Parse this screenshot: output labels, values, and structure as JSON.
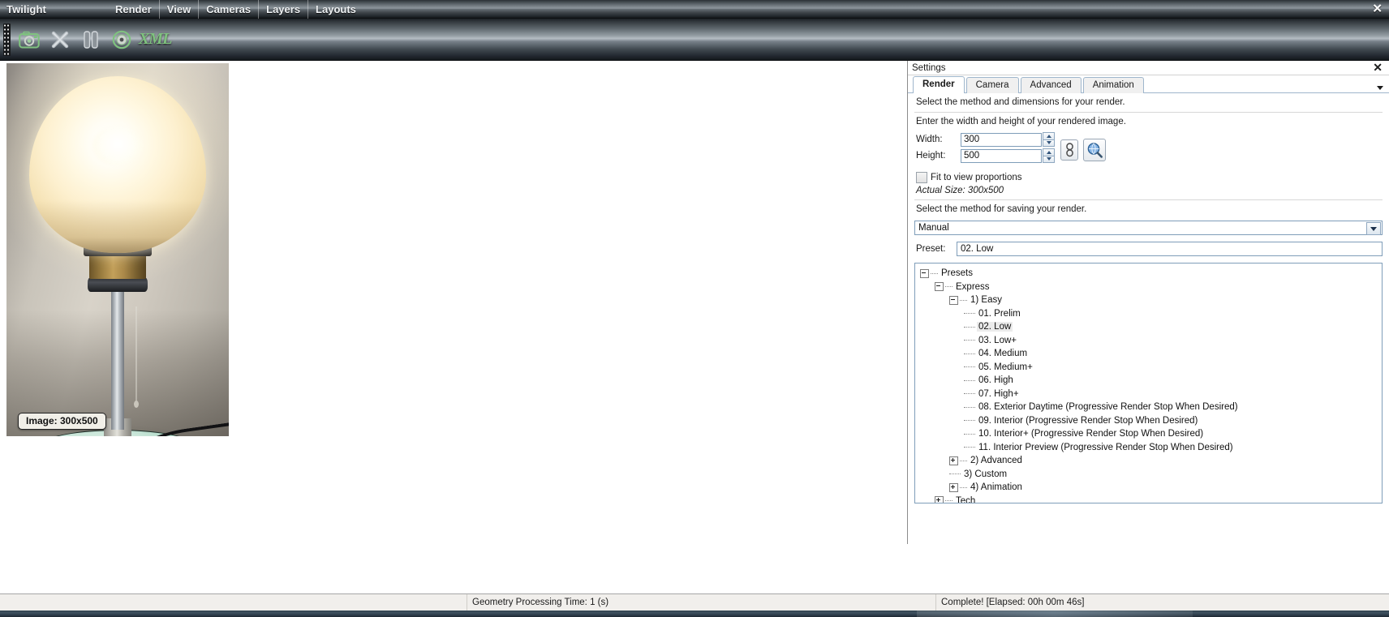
{
  "titlebar": {
    "app_name": "Twilight",
    "menu": [
      "Render",
      "View",
      "Cameras",
      "Layers",
      "Layouts"
    ],
    "close_label": "✕"
  },
  "toolbar": {
    "buttons": [
      {
        "name": "render-camera-button",
        "icon": "camera-icon"
      },
      {
        "name": "stop-render-button",
        "icon": "close-x-icon"
      },
      {
        "name": "pause-render-button",
        "icon": "pause-icon"
      },
      {
        "name": "progressive-render-button",
        "icon": "disc-icon"
      },
      {
        "name": "export-xml-button",
        "icon": "xml-icon",
        "label": "XML"
      }
    ]
  },
  "viewport": {
    "image_badge": "Image: 300x500"
  },
  "settings": {
    "panel_title": "Settings",
    "panel_close": "✕",
    "tabs": [
      {
        "label": "Render",
        "active": true
      },
      {
        "label": "Camera",
        "active": false
      },
      {
        "label": "Advanced",
        "active": false
      },
      {
        "label": "Animation",
        "active": false
      }
    ],
    "hint_method": "Select the method and dimensions for your render.",
    "hint_dimensions": "Enter the width and height of your rendered image.",
    "width_label": "Width:",
    "width_value": "300",
    "height_label": "Height:",
    "height_value": "500",
    "lock_aspect_icon": "chain-link-icon",
    "preview_zoom_icon": "magnifier-globe-icon",
    "fit_checkbox_label": "Fit to view proportions",
    "fit_checkbox_checked": false,
    "actual_size": "Actual Size: 300x500",
    "hint_saving": "Select the method for saving your render.",
    "save_method_value": "Manual",
    "preset_label": "Preset:",
    "preset_value": "02. Low"
  },
  "preset_tree": [
    {
      "label": "Presets",
      "depth": 0,
      "toggle": "minus",
      "selected": false
    },
    {
      "label": "Express",
      "depth": 1,
      "toggle": "minus",
      "selected": false
    },
    {
      "label": "1) Easy",
      "depth": 2,
      "toggle": "minus",
      "selected": false
    },
    {
      "label": "01. Prelim",
      "depth": 3,
      "toggle": "leaf",
      "selected": false
    },
    {
      "label": "02. Low",
      "depth": 3,
      "toggle": "leaf",
      "selected": true
    },
    {
      "label": "03. Low+",
      "depth": 3,
      "toggle": "leaf",
      "selected": false
    },
    {
      "label": "04. Medium",
      "depth": 3,
      "toggle": "leaf",
      "selected": false
    },
    {
      "label": "05. Medium+",
      "depth": 3,
      "toggle": "leaf",
      "selected": false
    },
    {
      "label": "06. High",
      "depth": 3,
      "toggle": "leaf",
      "selected": false
    },
    {
      "label": "07. High+",
      "depth": 3,
      "toggle": "leaf",
      "selected": false
    },
    {
      "label": "08. Exterior Daytime (Progressive Render Stop When Desired)",
      "depth": 3,
      "toggle": "leaf",
      "selected": false
    },
    {
      "label": "09. Interior (Progressive Render Stop When Desired)",
      "depth": 3,
      "toggle": "leaf",
      "selected": false
    },
    {
      "label": "10. Interior+ (Progressive Render Stop When Desired)",
      "depth": 3,
      "toggle": "leaf",
      "selected": false
    },
    {
      "label": "11. Interior Preview (Progressive Render Stop When Desired)",
      "depth": 3,
      "toggle": "leaf",
      "selected": false
    },
    {
      "label": "2) Advanced",
      "depth": 2,
      "toggle": "plus",
      "selected": false
    },
    {
      "label": "3) Custom",
      "depth": 2,
      "toggle": "leaf",
      "selected": false
    },
    {
      "label": "4) Animation",
      "depth": 2,
      "toggle": "plus",
      "selected": false
    },
    {
      "label": "Tech",
      "depth": 1,
      "toggle": "plus",
      "selected": false
    }
  ],
  "statusbar": {
    "left": "",
    "middle": "Geometry Processing Time: 1 (s)",
    "right": "Complete!  [Elapsed: 00h 00m 46s]"
  },
  "colors": {
    "accent_green": "#7fc27f",
    "field_border": "#7f9db9",
    "titlebar_text": "#f2f4f6",
    "selection_bg": "#ebebeb"
  }
}
